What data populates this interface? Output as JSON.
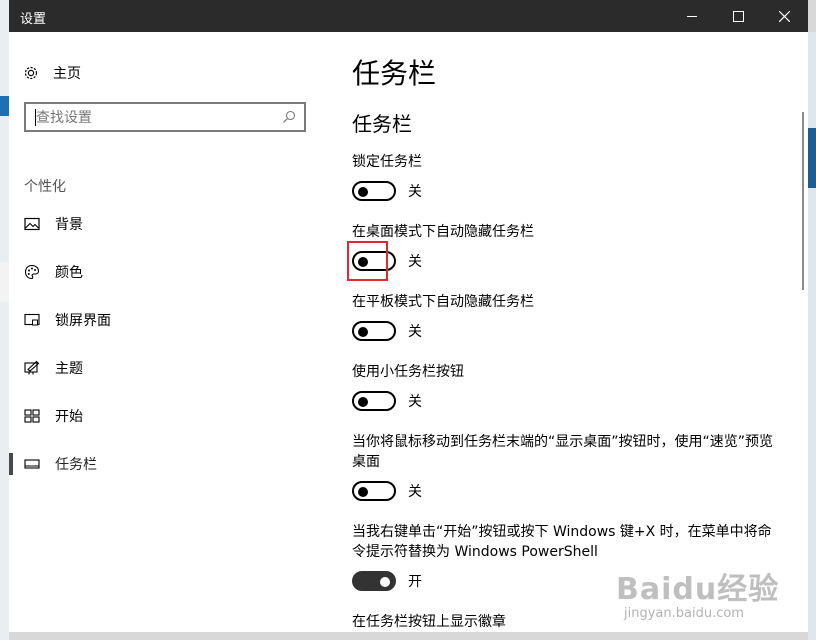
{
  "window": {
    "title": "设置"
  },
  "nav": {
    "home_label": "主页",
    "search_placeholder": "查找设置",
    "section": "个性化",
    "items": [
      {
        "label": "背景",
        "icon": "image-icon"
      },
      {
        "label": "颜色",
        "icon": "palette-icon"
      },
      {
        "label": "锁屏界面",
        "icon": "lock-screen-icon"
      },
      {
        "label": "主题",
        "icon": "theme-icon"
      },
      {
        "label": "开始",
        "icon": "start-icon"
      },
      {
        "label": "任务栏",
        "icon": "taskbar-icon"
      }
    ],
    "active_item": "任务栏"
  },
  "content": {
    "page_title": "任务栏",
    "section_title": "任务栏",
    "settings": [
      {
        "title": "锁定任务栏",
        "state_label": "关",
        "on": false
      },
      {
        "title": "在桌面模式下自动隐藏任务栏",
        "state_label": "关",
        "on": false
      },
      {
        "title": "在平板模式下自动隐藏任务栏",
        "state_label": "关",
        "on": false
      },
      {
        "title": "使用小任务栏按钮",
        "state_label": "关",
        "on": false
      },
      {
        "title": "当你将鼠标移动到任务栏末端的“显示桌面”按钮时，使用“速览”预览桌面",
        "state_label": "关",
        "on": false
      },
      {
        "title": "当我右键单击“开始”按钮或按下 Windows 键+X 时，在菜单中将命令提示符替换为 Windows PowerShell",
        "state_label": "开",
        "on": true
      },
      {
        "title": "在任务栏按钮上显示徽章"
      }
    ]
  },
  "watermark": {
    "logo": "Baidu经验",
    "url": "jingyan.baidu.com"
  },
  "colors": {
    "titlebar": "#2b2b2b",
    "highlight": "#e02b2b",
    "window": "#ffffff"
  }
}
